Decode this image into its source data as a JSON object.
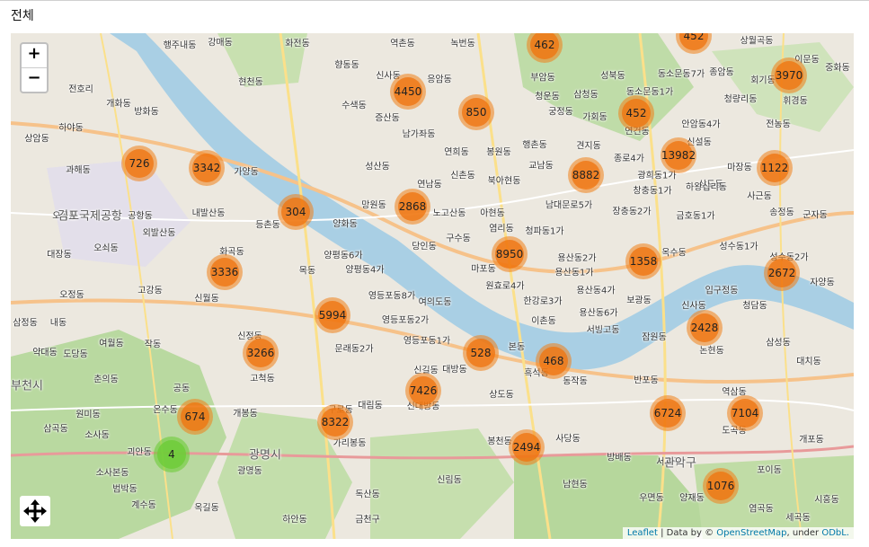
{
  "header": {
    "title": "전체"
  },
  "map": {
    "zoom_in_label": "+",
    "zoom_out_label": "−",
    "attribution": {
      "leaflet": "Leaflet",
      "sep": " | Data by © ",
      "osm": "OpenStreetMap",
      "under": ", under ",
      "odbl": "ODbL."
    },
    "clusters": [
      "462",
      "452",
      "3970",
      "4450",
      "850",
      "452",
      "726",
      "3342",
      "8882",
      "13982",
      "1122",
      "304",
      "2868",
      "8950",
      "1358",
      "3336",
      "2672",
      "5994",
      "2428",
      "3266",
      "528",
      "468",
      "7426",
      "674",
      "8322",
      "6724",
      "7104",
      "4",
      "2494",
      "1076"
    ],
    "labels": [
      "행주내동",
      "강매동",
      "화전동",
      "역촌동",
      "녹번동",
      "상월곡동",
      "이문동",
      "향동동",
      "신사동",
      "응암동",
      "부암동",
      "성북동",
      "동소문동7가",
      "종암동",
      "휘경동",
      "중화동",
      "현천동",
      "전호리",
      "개화동",
      "수색동",
      "증산동",
      "청운동",
      "삼청동",
      "동소문동1가",
      "청량리동",
      "회기동",
      "방화동",
      "상암동",
      "남가좌동",
      "궁정동",
      "가회동",
      "안암동4가",
      "전농동",
      "하야동",
      "연희동",
      "봉원동",
      "행촌동",
      "견지동",
      "연건동",
      "신설동",
      "상도동",
      "과해동",
      "가양동",
      "성산동",
      "신촌동",
      "북아현동",
      "교남동",
      "종로4가",
      "광희동1가",
      "마장동",
      "망원동",
      "연남동",
      "남대문로5가",
      "창충동1가",
      "하왕십리동",
      "사근동",
      "오곡동",
      "공항동",
      "내발산동",
      "등촌동",
      "양화동",
      "노고산동",
      "아현동",
      "장충동2가",
      "금호동1가",
      "송정동",
      "군자동",
      "외발산동",
      "화곡동",
      "양평동6가",
      "당인동",
      "구수동",
      "염리동",
      "청파동1가",
      "옥수동",
      "성수동1가",
      "대장동",
      "오쇠동",
      "목동",
      "양평동4가",
      "마포동",
      "용산동2가",
      "용산동1가",
      "성수동2가",
      "자양동",
      "고강동",
      "신월동",
      "영등포동8가",
      "여의도동",
      "원효로4가",
      "한강로3가",
      "용산동4가",
      "보광동",
      "입구정동",
      "오정동",
      "영등포동2가",
      "이촌동",
      "용산동6가",
      "신사동",
      "청담동",
      "삼정동",
      "내동",
      "신정동",
      "영등포동1가",
      "본동",
      "서빙고동",
      "잠원동",
      "논현동",
      "삼성동",
      "여월동",
      "작동",
      "문래동2가",
      "흑석동",
      "도당동",
      "약대동",
      "신길동",
      "대방동",
      "동작동",
      "반포동",
      "대치동",
      "춘의동",
      "고척동",
      "상도동",
      "역삼동",
      "공동",
      "원미동",
      "온수동",
      "개봉동",
      "구로동",
      "대림동",
      "신대방동",
      "개포동",
      "소사동",
      "삼곡동",
      "가리봉동",
      "도곡동",
      "괴안동",
      "봉천동",
      "사당동",
      "방배동",
      "포이동",
      "서초구",
      "소사본동",
      "광명동",
      "신림동",
      "남현동",
      "범박동",
      "독산동",
      "우면동",
      "양재동",
      "계수동",
      "옥길동",
      "하안동",
      "금천구",
      "염곡동",
      "시흥동",
      "세곡동"
    ],
    "big_labels": [
      "김포국제공항",
      "광명시",
      "부천시",
      "관악구"
    ]
  }
}
